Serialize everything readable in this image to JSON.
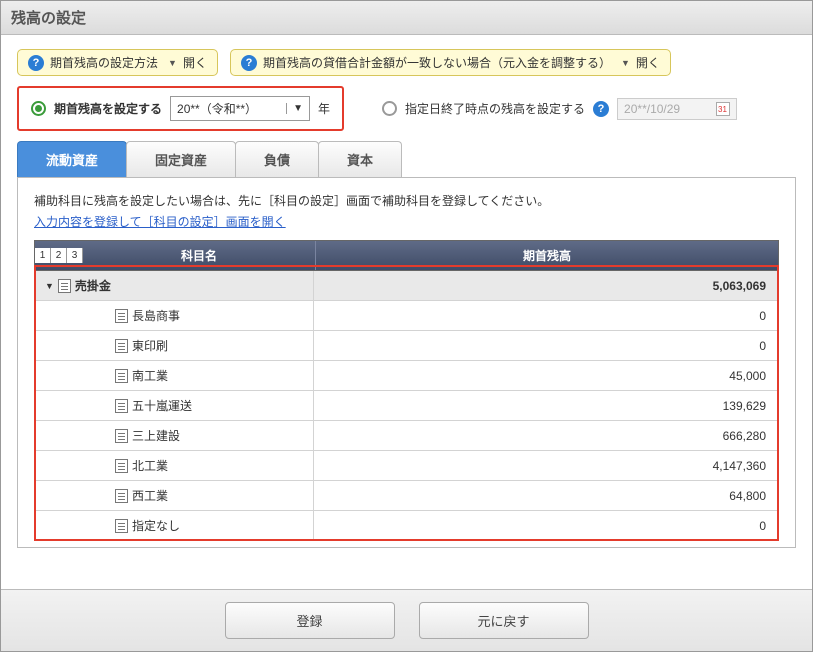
{
  "title": "残高の設定",
  "help": {
    "pill1": "期首残高の設定方法",
    "pill2": "期首残高の貸借合計金額が一致しない場合（元入金を調整する）",
    "open": "開く"
  },
  "options": {
    "opt1_label": "期首残高を設定する",
    "year_value": "20**（令和**）",
    "year_suffix": "年",
    "opt2_label": "指定日終了時点の残高を設定する",
    "date_value": "20**/10/29"
  },
  "tabs": {
    "t1": "流動資産",
    "t2": "固定資産",
    "t3": "負債",
    "t4": "資本"
  },
  "panel": {
    "note": "補助科目に残高を設定したい場合は、先に［科目の設定］画面で補助科目を登録してください。",
    "link": "入力内容を登録して［科目の設定］画面を開く"
  },
  "grid": {
    "levels": [
      "1",
      "2",
      "3"
    ],
    "header_name": "科目名",
    "header_balance": "期首残高",
    "rows": [
      {
        "type": "parent",
        "name": "売掛金",
        "value": "5,063,069"
      },
      {
        "type": "child",
        "name": "長島商事",
        "value": "0"
      },
      {
        "type": "child",
        "name": "東印刷",
        "value": "0"
      },
      {
        "type": "child",
        "name": "南工業",
        "value": "45,000"
      },
      {
        "type": "child",
        "name": "五十嵐運送",
        "value": "139,629"
      },
      {
        "type": "child",
        "name": "三上建設",
        "value": "666,280"
      },
      {
        "type": "child",
        "name": "北工業",
        "value": "4,147,360"
      },
      {
        "type": "child",
        "name": "西工業",
        "value": "64,800"
      },
      {
        "type": "child",
        "name": "指定なし",
        "value": "0"
      }
    ]
  },
  "footer": {
    "save": "登録",
    "revert": "元に戻す"
  }
}
